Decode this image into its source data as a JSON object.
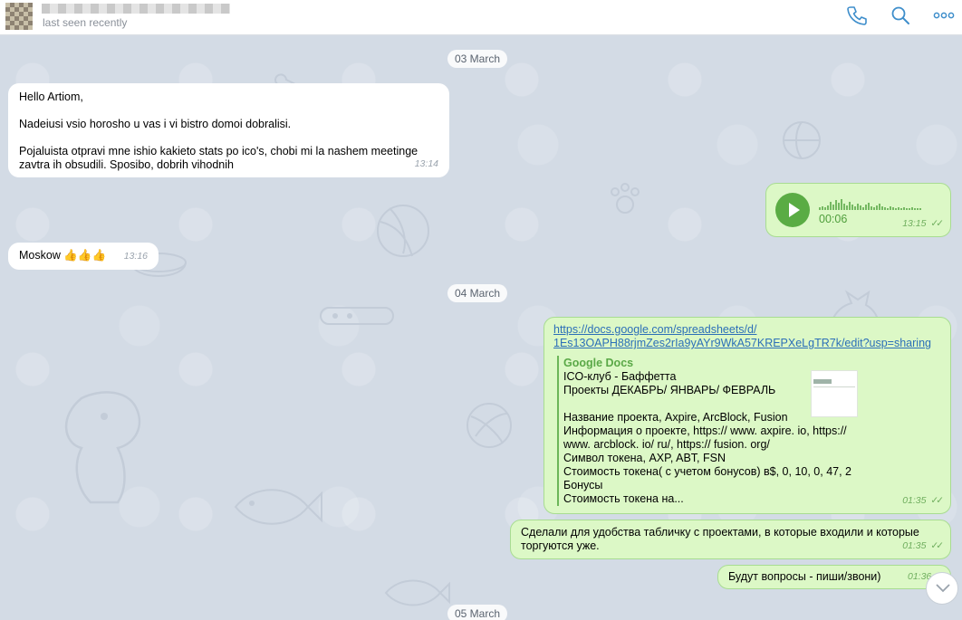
{
  "header": {
    "status": "last seen recently",
    "icons": [
      "phone-icon",
      "search-icon",
      "more-icon"
    ],
    "accent": "#3e8ecb"
  },
  "dates": [
    "03 March",
    "04 March",
    "05 March"
  ],
  "messages": [
    {
      "lines": [
        "Hello Artiom,",
        "Nadeiusi vsio horosho u vas i vi bistro domoi dobralisi.",
        "Pojaluista otpravi mne ishio kakieto stats po ico's, chobi mi la nashem meetinge zavtra ih obsudili. Sposibo, dobrih vihodnih"
      ],
      "time": "13:14"
    },
    {
      "duration": "00:06",
      "time": "13:15",
      "ticks": "✓✓"
    },
    {
      "text": "Moskow 👍👍👍",
      "time": "13:16"
    },
    {
      "link": "https://docs.google.com/spreadsheets/d/1Es13OAPH88rjmZes2rIa9yAYr9WkA57KREPXeLgTR7k/edit?usp=sharing",
      "link_lines": [
        "https://docs.google.com/spreadsheets/d/",
        "1Es13OAPH88rjmZes2rIa9yAYr9WkA57KREPXeLgTR7k/edit?usp=sharing"
      ],
      "preview": {
        "site": "Google Docs",
        "title": "ICO-клуб - Баффетта",
        "subtitle": "Проекты ДЕКАБРЬ/ ЯНВАРЬ/ ФЕВРАЛЬ",
        "body": [
          " Название проекта, Axpire, ArcBlock, Fusion",
          " Информация о проекте, https:// www. axpire. io, https://",
          "www. arcblock. io/ ru/, https:// fusion. org/",
          " Символ токена, AXP, ABT, FSN",
          " Стоимость токена( с учетом бонусов) в$, 0, 10, 0, 47, 2",
          " Бонусы",
          " Стоимость токена на..."
        ]
      },
      "time": "01:35",
      "ticks": "✓✓"
    },
    {
      "lines": [
        "Сделали для удобства табличку с проектами, в которые входили и которые",
        "торгуются уже."
      ],
      "time": "01:35",
      "ticks": "✓✓"
    },
    {
      "text": "Будут вопросы - пиши/звони)",
      "time": "01:36",
      "ticks": "✓"
    }
  ],
  "colors": {
    "incoming": "#ffffff",
    "outgoing": "#dcf8c6",
    "outgoing_border": "#a8dc91",
    "chat_bg": "#d3dbe5"
  }
}
